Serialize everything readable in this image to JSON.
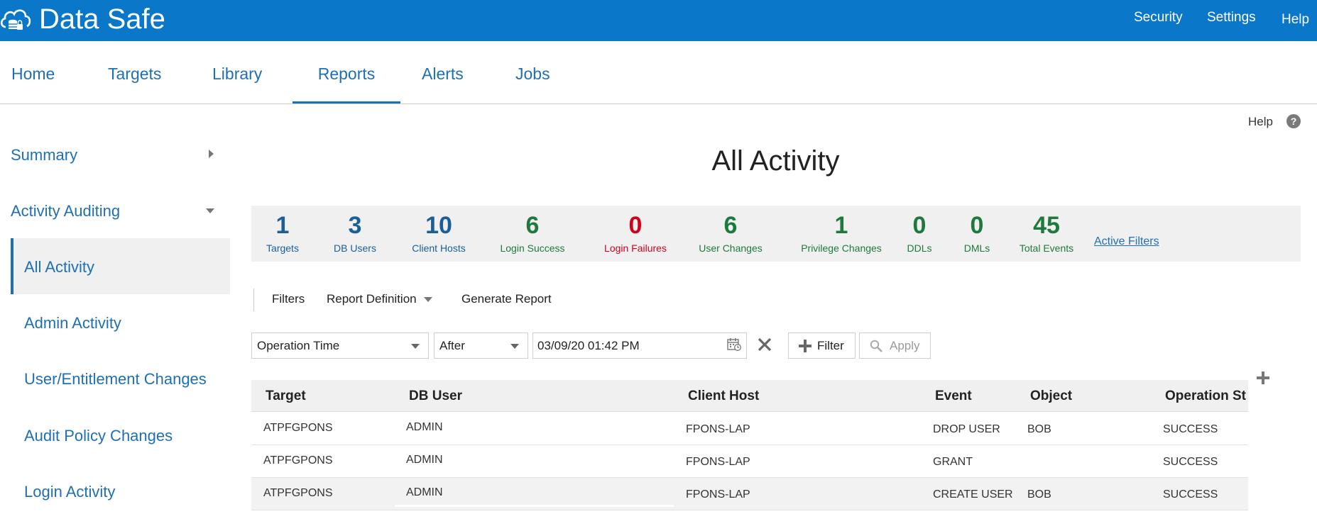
{
  "header": {
    "app_title": "Data Safe",
    "links": {
      "security": "Security",
      "settings": "Settings",
      "help": "Help"
    }
  },
  "nav_tabs": [
    {
      "label": "Home"
    },
    {
      "label": "Targets"
    },
    {
      "label": "Library"
    },
    {
      "label": "Reports",
      "active": true
    },
    {
      "label": "Alerts"
    },
    {
      "label": "Jobs"
    }
  ],
  "help": {
    "label": "Help",
    "icon": "?"
  },
  "sidebar": {
    "groups": [
      {
        "label": "Summary",
        "icon": "caret-right-icon"
      },
      {
        "label": "Activity Auditing",
        "icon": "caret-down-icon"
      }
    ],
    "items": [
      {
        "label": "All Activity",
        "selected": true
      },
      {
        "label": "Admin Activity"
      },
      {
        "label": "User/Entitlement Changes"
      },
      {
        "label": "Audit Policy Changes"
      },
      {
        "label": "Login Activity"
      }
    ]
  },
  "page_title": "All Activity",
  "stats": [
    {
      "value": "1",
      "label": "Targets",
      "color": "#1a5e9a"
    },
    {
      "value": "3",
      "label": "DB Users",
      "color": "#1a5e9a"
    },
    {
      "value": "10",
      "label": "Client Hosts",
      "color": "#1a5e9a"
    },
    {
      "value": "6",
      "label": "Login Success",
      "color": "#1e7a3c"
    },
    {
      "value": "0",
      "label": "Login Failures",
      "color": "#d0021b"
    },
    {
      "value": "6",
      "label": "User Changes",
      "color": "#1e7a3c"
    },
    {
      "value": "1",
      "label": "Privilege Changes",
      "color": "#1e7a3c"
    },
    {
      "value": "0",
      "label": "DDLs",
      "color": "#1e7a3c"
    },
    {
      "value": "0",
      "label": "DMLs",
      "color": "#1e7a3c"
    },
    {
      "value": "45",
      "label": "Total Events",
      "color": "#1e7a3c"
    }
  ],
  "active_filters": "Active Filters",
  "toolbar": {
    "filters": "Filters",
    "report_definition": "Report Definition",
    "generate_report": "Generate Report"
  },
  "filter_row": {
    "field": "Operation Time",
    "operator": "After",
    "value": "03/09/20 01:42 PM",
    "filter_button": "Filter",
    "apply_button": "Apply"
  },
  "table": {
    "columns": [
      "Target",
      "DB User",
      "Client Host",
      "Event",
      "Object",
      "Operation St"
    ],
    "rows": [
      [
        "ATPFGPONS",
        "ADMIN",
        "FPONS-LAP",
        "DROP USER",
        "BOB",
        "SUCCESS"
      ],
      [
        "ATPFGPONS",
        "ADMIN",
        "FPONS-LAP",
        "GRANT",
        "",
        "SUCCESS"
      ],
      [
        "ATPFGPONS",
        "ADMIN",
        "FPONS-LAP",
        "CREATE USER",
        "BOB",
        "SUCCESS"
      ]
    ]
  }
}
